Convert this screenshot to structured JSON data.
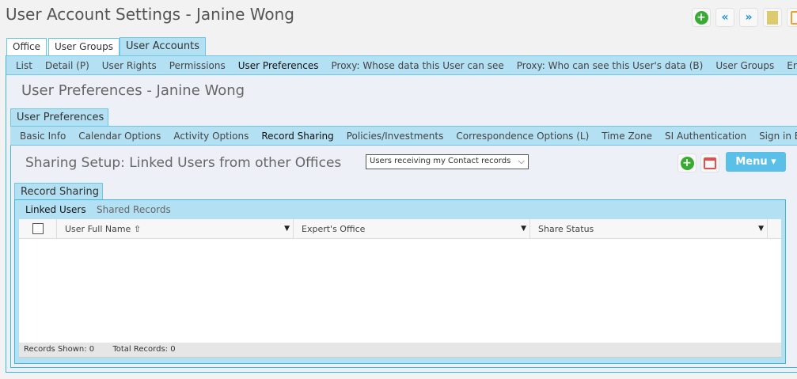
{
  "header": {
    "title": "User Account Settings - Janine Wong",
    "toolbar_icons": [
      "add-icon",
      "previous-icon",
      "next-icon",
      "notes-icon",
      "export-icon"
    ]
  },
  "top_tabs": [
    {
      "label": "Office"
    },
    {
      "label": "User Groups"
    },
    {
      "label": "User Accounts",
      "active": true
    }
  ],
  "account_nav": [
    "List",
    "Detail (P)",
    "User Rights",
    "Permissions",
    "User Preferences",
    "Proxy: Whose data this User can see",
    "Proxy: Who can see this User's data (B)",
    "User Groups",
    "Enterprise O"
  ],
  "section_title": "User Preferences - Janine Wong",
  "pref_tab": "User Preferences",
  "pref_nav": [
    "Basic Info",
    "Calendar Options",
    "Activity Options",
    "Record Sharing",
    "Policies/Investments",
    "Correspondence Options (L)",
    "Time Zone",
    "SI Authentication",
    "Sign in Events (Y)"
  ],
  "sharing": {
    "title": "Sharing Setup: Linked Users from other Offices",
    "select_value": "Users receiving my Contact records",
    "menu_label": "Menu ▾",
    "colors": {
      "accent": "#5bc0e8",
      "nav": "#b3e0f2"
    }
  },
  "record_tab": "Record Sharing",
  "record_nav": [
    "Linked Users",
    "Shared Records"
  ],
  "table": {
    "columns": [
      "User Full Name ⇧",
      "Expert's Office",
      "Share Status"
    ],
    "rows": []
  },
  "footer": {
    "shown": "Records Shown: 0",
    "total": "Total Records: 0"
  }
}
